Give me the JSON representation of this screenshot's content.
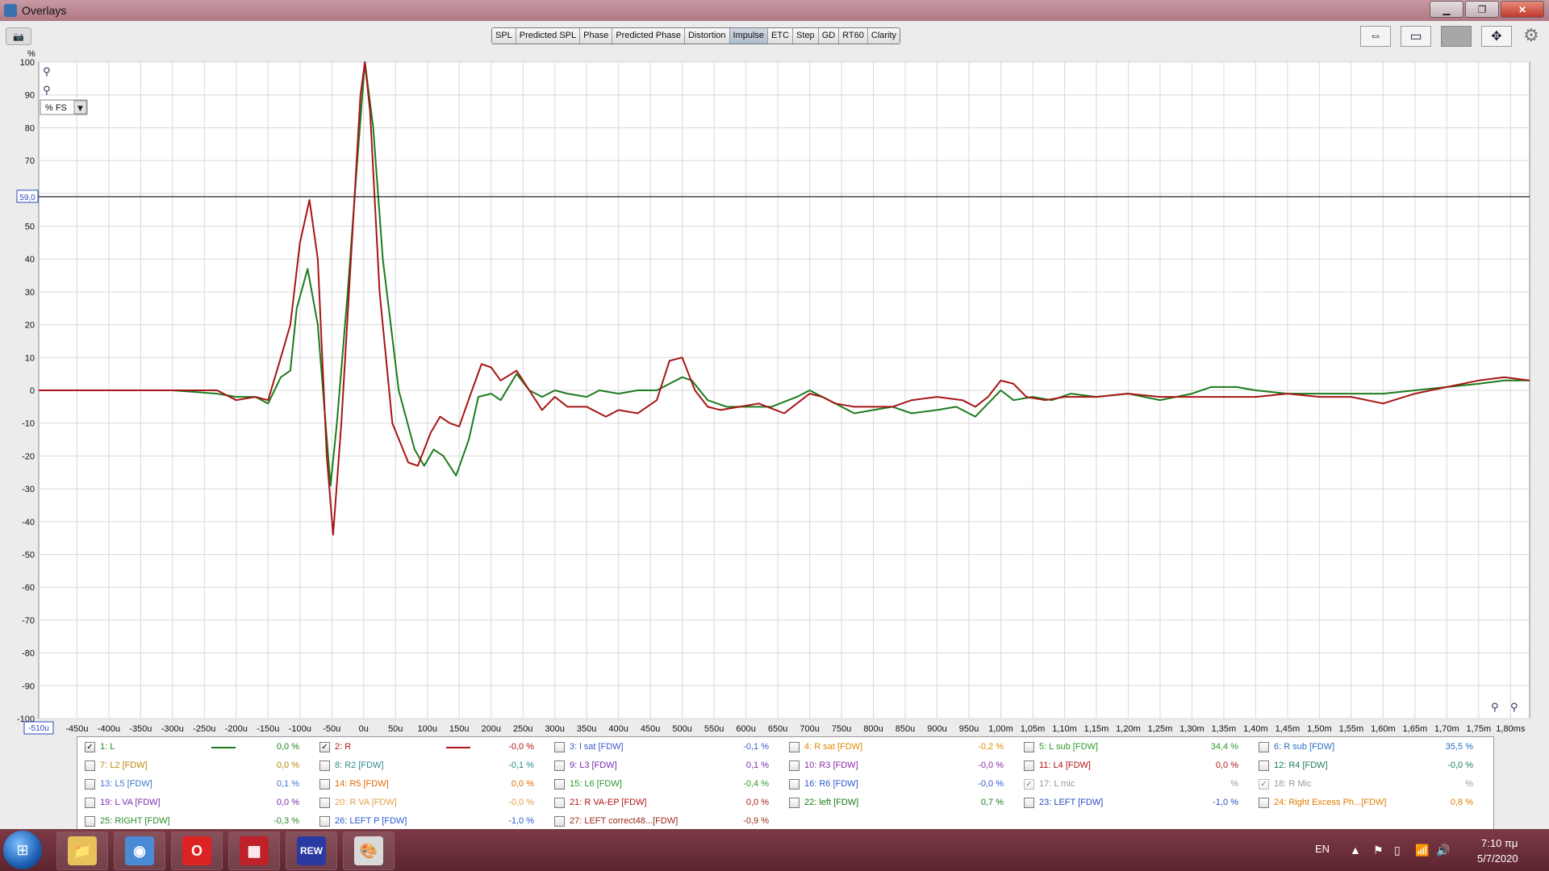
{
  "window": {
    "title": "Overlays",
    "min_icon": "minimize-icon",
    "max_icon": "maximize-icon",
    "close_icon": "close-icon"
  },
  "tabs": [
    {
      "label": "SPL",
      "active": false
    },
    {
      "label": "Predicted SPL",
      "active": false
    },
    {
      "label": "Phase",
      "active": false
    },
    {
      "label": "Predicted Phase",
      "active": false
    },
    {
      "label": "Distortion",
      "active": false
    },
    {
      "label": "Impulse",
      "active": true
    },
    {
      "label": "ETC",
      "active": false
    },
    {
      "label": "Step",
      "active": false
    },
    {
      "label": "GD",
      "active": false
    },
    {
      "label": "RT60",
      "active": false
    },
    {
      "label": "Clarity",
      "active": false
    }
  ],
  "plot": {
    "y_unit": "%",
    "scale_select": "% FS",
    "cursor_y_label": "59,0",
    "cursor_x_label": "-510u",
    "y_ticks": [
      "100",
      "90",
      "80",
      "70",
      "60",
      "50",
      "40",
      "30",
      "20",
      "10",
      "0",
      "-10",
      "-20",
      "-30",
      "-40",
      "-50",
      "-60",
      "-70",
      "-80",
      "-90",
      "-100"
    ],
    "x_ticks": [
      "-450u",
      "-400u",
      "-350u",
      "-300u",
      "-250u",
      "-200u",
      "-150u",
      "-100u",
      "-50u",
      "0u",
      "50u",
      "100u",
      "150u",
      "200u",
      "250u",
      "300u",
      "350u",
      "400u",
      "450u",
      "500u",
      "550u",
      "600u",
      "650u",
      "700u",
      "750u",
      "800u",
      "850u",
      "900u",
      "950u",
      "1,00m",
      "1,05m",
      "1,10m",
      "1,15m",
      "1,20m",
      "1,25m",
      "1,30m",
      "1,35m",
      "1,40m",
      "1,45m",
      "1,50m",
      "1,55m",
      "1,60m",
      "1,65m",
      "1,70m",
      "1,75m",
      "1,80ms"
    ]
  },
  "chart_data": {
    "type": "line",
    "ylabel": "%",
    "xlim": [
      -510,
      1830
    ],
    "ylim": [
      -100,
      100
    ],
    "cursor_y": 59,
    "series": [
      {
        "name": "1: L",
        "color": "#1d7a1d",
        "points": [
          [
            -510,
            0
          ],
          [
            -300,
            0
          ],
          [
            -230,
            -1
          ],
          [
            -200,
            -2
          ],
          [
            -170,
            -2
          ],
          [
            -150,
            -4
          ],
          [
            -130,
            4
          ],
          [
            -115,
            6
          ],
          [
            -105,
            25
          ],
          [
            -88,
            37
          ],
          [
            -72,
            20
          ],
          [
            -52,
            -29
          ],
          [
            -42,
            -10
          ],
          [
            -25,
            30
          ],
          [
            -10,
            70
          ],
          [
            2,
            100
          ],
          [
            15,
            80
          ],
          [
            30,
            40
          ],
          [
            55,
            0
          ],
          [
            80,
            -18
          ],
          [
            95,
            -23
          ],
          [
            110,
            -18
          ],
          [
            125,
            -20
          ],
          [
            145,
            -26
          ],
          [
            165,
            -15
          ],
          [
            180,
            -2
          ],
          [
            200,
            -1
          ],
          [
            215,
            -3
          ],
          [
            240,
            5
          ],
          [
            260,
            0
          ],
          [
            280,
            -2
          ],
          [
            300,
            0
          ],
          [
            320,
            -1
          ],
          [
            350,
            -2
          ],
          [
            370,
            0
          ],
          [
            400,
            -1
          ],
          [
            430,
            0
          ],
          [
            460,
            0
          ],
          [
            480,
            2
          ],
          [
            500,
            4
          ],
          [
            515,
            3
          ],
          [
            540,
            -3
          ],
          [
            570,
            -5
          ],
          [
            600,
            -5
          ],
          [
            640,
            -5
          ],
          [
            680,
            -2
          ],
          [
            700,
            0
          ],
          [
            730,
            -3
          ],
          [
            770,
            -7
          ],
          [
            800,
            -6
          ],
          [
            830,
            -5
          ],
          [
            860,
            -7
          ],
          [
            900,
            -6
          ],
          [
            930,
            -5
          ],
          [
            960,
            -8
          ],
          [
            980,
            -4
          ],
          [
            1000,
            0
          ],
          [
            1020,
            -3
          ],
          [
            1050,
            -2
          ],
          [
            1080,
            -3
          ],
          [
            1110,
            -1
          ],
          [
            1150,
            -2
          ],
          [
            1200,
            -1
          ],
          [
            1250,
            -3
          ],
          [
            1300,
            -1
          ],
          [
            1330,
            1
          ],
          [
            1370,
            1
          ],
          [
            1400,
            0
          ],
          [
            1450,
            -1
          ],
          [
            1500,
            -1
          ],
          [
            1550,
            -1
          ],
          [
            1600,
            -1
          ],
          [
            1650,
            0
          ],
          [
            1700,
            1
          ],
          [
            1750,
            2
          ],
          [
            1790,
            3
          ],
          [
            1830,
            3
          ]
        ]
      },
      {
        "name": "2: R",
        "color": "#a61515",
        "points": [
          [
            -510,
            0
          ],
          [
            -300,
            0
          ],
          [
            -230,
            0
          ],
          [
            -200,
            -3
          ],
          [
            -170,
            -2
          ],
          [
            -150,
            -3
          ],
          [
            -130,
            10
          ],
          [
            -115,
            20
          ],
          [
            -100,
            45
          ],
          [
            -85,
            58
          ],
          [
            -72,
            40
          ],
          [
            -58,
            -20
          ],
          [
            -48,
            -44
          ],
          [
            -35,
            -10
          ],
          [
            -20,
            40
          ],
          [
            -5,
            90
          ],
          [
            2,
            100
          ],
          [
            10,
            85
          ],
          [
            25,
            30
          ],
          [
            45,
            -10
          ],
          [
            70,
            -22
          ],
          [
            85,
            -23
          ],
          [
            105,
            -13
          ],
          [
            120,
            -8
          ],
          [
            135,
            -10
          ],
          [
            150,
            -11
          ],
          [
            170,
            0
          ],
          [
            185,
            8
          ],
          [
            200,
            7
          ],
          [
            215,
            3
          ],
          [
            240,
            6
          ],
          [
            260,
            0
          ],
          [
            280,
            -6
          ],
          [
            300,
            -2
          ],
          [
            320,
            -5
          ],
          [
            350,
            -5
          ],
          [
            380,
            -8
          ],
          [
            400,
            -6
          ],
          [
            430,
            -7
          ],
          [
            460,
            -3
          ],
          [
            480,
            9
          ],
          [
            500,
            10
          ],
          [
            520,
            0
          ],
          [
            540,
            -5
          ],
          [
            560,
            -6
          ],
          [
            590,
            -5
          ],
          [
            620,
            -4
          ],
          [
            660,
            -7
          ],
          [
            700,
            -1
          ],
          [
            720,
            -2
          ],
          [
            740,
            -4
          ],
          [
            770,
            -5
          ],
          [
            800,
            -5
          ],
          [
            830,
            -5
          ],
          [
            860,
            -3
          ],
          [
            900,
            -2
          ],
          [
            940,
            -3
          ],
          [
            960,
            -5
          ],
          [
            980,
            -2
          ],
          [
            1000,
            3
          ],
          [
            1020,
            2
          ],
          [
            1040,
            -2
          ],
          [
            1070,
            -3
          ],
          [
            1100,
            -2
          ],
          [
            1150,
            -2
          ],
          [
            1200,
            -1
          ],
          [
            1250,
            -2
          ],
          [
            1300,
            -2
          ],
          [
            1350,
            -2
          ],
          [
            1400,
            -2
          ],
          [
            1450,
            -1
          ],
          [
            1500,
            -2
          ],
          [
            1550,
            -2
          ],
          [
            1600,
            -4
          ],
          [
            1650,
            -1
          ],
          [
            1700,
            1
          ],
          [
            1750,
            3
          ],
          [
            1790,
            4
          ],
          [
            1830,
            3
          ]
        ]
      }
    ]
  },
  "legend": {
    "columns": 6,
    "items": [
      {
        "label": "1: L",
        "value": "0,0 %",
        "color": "#1a8a1a",
        "checked": true,
        "line": "#1d7a1d"
      },
      {
        "label": "2: R",
        "value": "-0,0 %",
        "color": "#b01515",
        "checked": true,
        "line": "#b01515"
      },
      {
        "label": "3: l sat [FDW]",
        "value": "-0,1 %",
        "color": "#3a5ad0",
        "checked": false
      },
      {
        "label": "4: R sat [FDW]",
        "value": "-0,2 %",
        "color": "#e08a00",
        "checked": false
      },
      {
        "label": "5: L sub [FDW]",
        "value": "34,4 %",
        "color": "#2a9a2a",
        "checked": false
      },
      {
        "label": "6: R sub [FDW]",
        "value": "35,5 %",
        "color": "#2a70c0",
        "checked": false
      },
      {
        "label": "7: L2 [FDW]",
        "value": "0,0 %",
        "color": "#b8860b",
        "checked": false
      },
      {
        "label": "8: R2 [FDW]",
        "value": "-0,1 %",
        "color": "#2a8a8a",
        "checked": false
      },
      {
        "label": "9: L3 [FDW]",
        "value": "0,1 %",
        "color": "#7a2ab0",
        "checked": false
      },
      {
        "label": "10: R3 [FDW]",
        "value": "-0,0 %",
        "color": "#8a2ab0",
        "checked": false
      },
      {
        "label": "11: L4 [FDW]",
        "value": "0,0 %",
        "color": "#b01515",
        "checked": false
      },
      {
        "label": "12: R4 [FDW]",
        "value": "-0,0 %",
        "color": "#1a7a5a",
        "checked": false
      },
      {
        "label": "13: L5 [FDW]",
        "value": "0,1 %",
        "color": "#3a7ad0",
        "checked": false
      },
      {
        "label": "14: R5 [FDW]",
        "value": "0,0 %",
        "color": "#e06a00",
        "checked": false
      },
      {
        "label": "15: L6 [FDW]",
        "value": "-0,4 %",
        "color": "#2a9a2a",
        "checked": false
      },
      {
        "label": "16: R6 [FDW]",
        "value": "-0,0 %",
        "color": "#2a5ad0",
        "checked": false
      },
      {
        "label": "17: L mic",
        "value": "%",
        "color": "#999999",
        "checked": true,
        "disabled": true
      },
      {
        "label": "18: R Mic",
        "value": "%",
        "color": "#999999",
        "checked": true,
        "disabled": true
      },
      {
        "label": "19: L VA [FDW]",
        "value": "0,0 %",
        "color": "#7a2ab0",
        "checked": false
      },
      {
        "label": "20: R  VA [FDW]",
        "value": "-0,0 %",
        "color": "#e0a040",
        "checked": false
      },
      {
        "label": "21: R VA-EP [FDW]",
        "value": "0,0 %",
        "color": "#b01515",
        "checked": false
      },
      {
        "label": "22: left [FDW]",
        "value": "0,7 %",
        "color": "#1a7a1a",
        "checked": false
      },
      {
        "label": "23: LEFT [FDW]",
        "value": "-1,0 %",
        "color": "#2a4ac0",
        "checked": false
      },
      {
        "label": "24: Right Excess Ph...[FDW]",
        "value": "0,8 %",
        "color": "#e07a00",
        "checked": false
      },
      {
        "label": "25: RIGHT [FDW]",
        "value": "-0,3 %",
        "color": "#2a8a2a",
        "checked": false
      },
      {
        "label": "26: LEFT P [FDW]",
        "value": "-1,0 %",
        "color": "#2a5ad0",
        "checked": false
      },
      {
        "label": "27: LEFT correct48...[FDW]",
        "value": "-0,9 %",
        "color": "#9a2a15",
        "checked": false
      }
    ]
  },
  "taskbar": {
    "language": "EN",
    "time": "7:10 πμ",
    "date": "5/7/2020",
    "apps": [
      {
        "name": "explorer-app",
        "icon": "folder-icon"
      },
      {
        "name": "chrome-app",
        "icon": "chrome-icon"
      },
      {
        "name": "opera-app",
        "icon": "opera-icon"
      },
      {
        "name": "app-red",
        "icon": "grid-app-icon"
      },
      {
        "name": "rew-app",
        "icon": "rew-icon",
        "label": "REW"
      },
      {
        "name": "paint-app",
        "icon": "paint-icon"
      }
    ]
  }
}
